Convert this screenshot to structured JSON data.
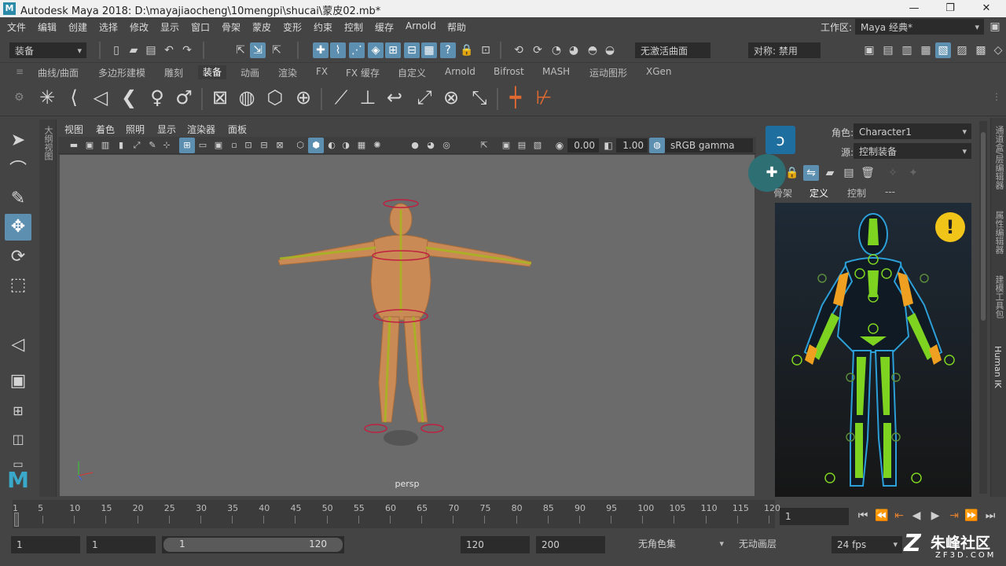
{
  "window": {
    "app_icon": "M",
    "title": "Autodesk Maya 2018: D:\\mayajiaocheng\\10mengpi\\shucai\\蒙皮02.mb*",
    "minimize": "—",
    "restore": "❐",
    "close": "✕"
  },
  "menu": {
    "items": [
      "文件",
      "编辑",
      "创建",
      "选择",
      "修改",
      "显示",
      "窗口",
      "骨架",
      "蒙皮",
      "变形",
      "约束",
      "控制",
      "缓存",
      "Arnold",
      "帮助"
    ],
    "workspace_label": "工作区:",
    "workspace_value": "Maya 经典*"
  },
  "status_line": {
    "menuset": "装备",
    "live_surface": "无激活曲面",
    "symmetry": "对称: 禁用"
  },
  "shelf": {
    "tabs": [
      "曲线/曲面",
      "多边形建模",
      "雕刻",
      "装备",
      "动画",
      "渲染",
      "FX",
      "FX 缓存",
      "自定义",
      "Arnold",
      "Bifrost",
      "MASH",
      "运动图形",
      "XGen"
    ],
    "active_tab": "装备"
  },
  "viewport": {
    "menu": [
      "视图",
      "着色",
      "照明",
      "显示",
      "渲染器",
      "面板"
    ],
    "exposure": "0.00",
    "gamma": "1.00",
    "colorspace": "sRGB gamma",
    "camera": "persp"
  },
  "outliner_strip": "大纲视图",
  "hik": {
    "character_label": "角色:",
    "character_value": "Character1",
    "source_label": "源:",
    "source_value": "控制装备",
    "tabs": [
      "骨架",
      "定义",
      "控制",
      "---"
    ],
    "active_tab": "定义",
    "warning": "!"
  },
  "side_tabs": [
    "通道盒/层编辑器",
    "属性编辑器",
    "建模工具包",
    "Human IK"
  ],
  "timeline": {
    "ticks": [
      1,
      5,
      10,
      15,
      20,
      25,
      30,
      35,
      40,
      45,
      50,
      55,
      60,
      65,
      70,
      75,
      80,
      85,
      90,
      95,
      100,
      105,
      110,
      115,
      120
    ],
    "current_frame": "1"
  },
  "range": {
    "start": "1",
    "playback_start": "1",
    "range_start_label": "1",
    "range_end_label": "120",
    "playback_end": "120",
    "end": "200",
    "character_set": "无角色集",
    "anim_layer": "无动画层",
    "fps": "24 fps"
  },
  "watermark": {
    "text": "朱峰社区",
    "url": "ZF3D.COM"
  },
  "colors": {
    "accent": "#5d8fb0",
    "hik_body": "#0f1a24",
    "hik_green": "#7ed321",
    "hik_orange": "#f0a020",
    "warning": "#f0c419"
  }
}
